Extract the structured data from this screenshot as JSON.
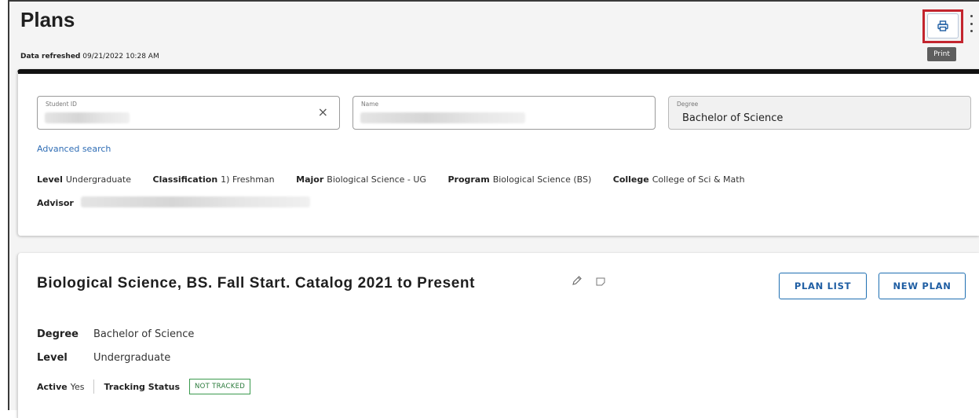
{
  "header": {
    "title": "Plans",
    "refresh_label": "Data refreshed",
    "refresh_value": "09/21/2022 10:28 AM",
    "print_tooltip": "Print",
    "highlight_color": "#c3252e"
  },
  "search": {
    "student_id": {
      "label": "Student ID",
      "clear_icon": "×"
    },
    "name": {
      "label": "Name"
    },
    "degree": {
      "label": "Degree",
      "value": "Bachelor of Science"
    },
    "advanced_link": "Advanced search"
  },
  "student": {
    "level": {
      "label": "Level",
      "value": "Undergraduate"
    },
    "classification": {
      "label": "Classification",
      "value": "1) Freshman"
    },
    "major": {
      "label": "Major",
      "value": "Biological Science - UG"
    },
    "program": {
      "label": "Program",
      "value": "Biological Science (BS)"
    },
    "college": {
      "label": "College",
      "value": "College of Sci & Math"
    },
    "advisor": {
      "label": "Advisor"
    }
  },
  "plan": {
    "title": "Biological Science, BS. Fall Start. Catalog 2021 to Present",
    "plan_list_button": "PLAN LIST",
    "new_plan_button": "NEW PLAN",
    "degree": {
      "label": "Degree",
      "value": "Bachelor of Science"
    },
    "level": {
      "label": "Level",
      "value": "Undergraduate"
    },
    "active": {
      "label": "Active",
      "value": "Yes"
    },
    "tracking": {
      "label": "Tracking Status",
      "value": "NOT TRACKED"
    }
  },
  "icons": [
    "print-icon",
    "more-vertical-icon",
    "close-icon",
    "pencil-icon",
    "note-icon"
  ]
}
